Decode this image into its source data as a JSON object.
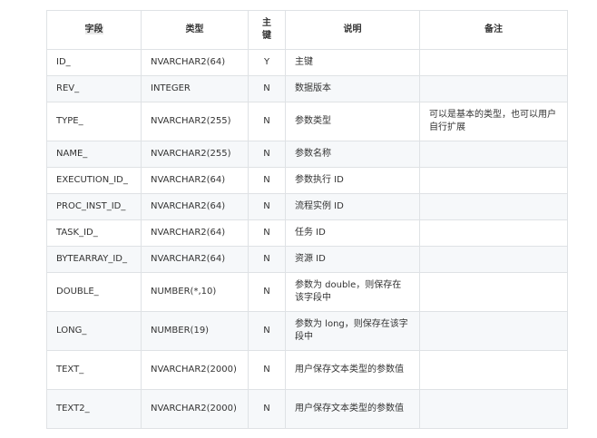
{
  "table": {
    "headers": {
      "field": "字段",
      "type": "类型",
      "pk": "主\n键",
      "desc": "说明",
      "note": "备注"
    },
    "rows": [
      {
        "field": "ID_",
        "type": "NVARCHAR2(64)",
        "pk": "Y",
        "desc": "主键",
        "note": ""
      },
      {
        "field": "REV_",
        "type": "INTEGER",
        "pk": "N",
        "desc": "数据版本",
        "note": ""
      },
      {
        "field": "TYPE_",
        "type": "NVARCHAR2(255)",
        "pk": "N",
        "desc": "参数类型",
        "note": "可以是基本的类型，也可以用户自行扩展"
      },
      {
        "field": "NAME_",
        "type": "NVARCHAR2(255)",
        "pk": "N",
        "desc": "参数名称",
        "note": ""
      },
      {
        "field": "EXECUTION_ID_",
        "type": "NVARCHAR2(64)",
        "pk": "N",
        "desc": "参数执行 ID",
        "note": ""
      },
      {
        "field": "PROC_INST_ID_",
        "type": "NVARCHAR2(64)",
        "pk": "N",
        "desc": "流程实例 ID",
        "note": ""
      },
      {
        "field": "TASK_ID_",
        "type": "NVARCHAR2(64)",
        "pk": "N",
        "desc": "任务 ID",
        "note": ""
      },
      {
        "field": "BYTEARRAY_ID_",
        "type": "NVARCHAR2(64)",
        "pk": "N",
        "desc": "资源 ID",
        "note": ""
      },
      {
        "field": "DOUBLE_",
        "type": "NUMBER(*,10)",
        "pk": "N",
        "desc": "参数为 double，则保存在该字段中",
        "note": ""
      },
      {
        "field": "LONG_",
        "type": "NUMBER(19)",
        "pk": "N",
        "desc": "参数为 long，则保存在该字段中",
        "note": ""
      },
      {
        "field": "TEXT_",
        "type": "NVARCHAR2(2000)",
        "pk": "N",
        "desc": "用户保存文本类型的参数值",
        "note": ""
      },
      {
        "field": "TEXT2_",
        "type": "NVARCHAR2(2000)",
        "pk": "N",
        "desc": "用户保存文本类型的参数值",
        "note": ""
      }
    ]
  }
}
